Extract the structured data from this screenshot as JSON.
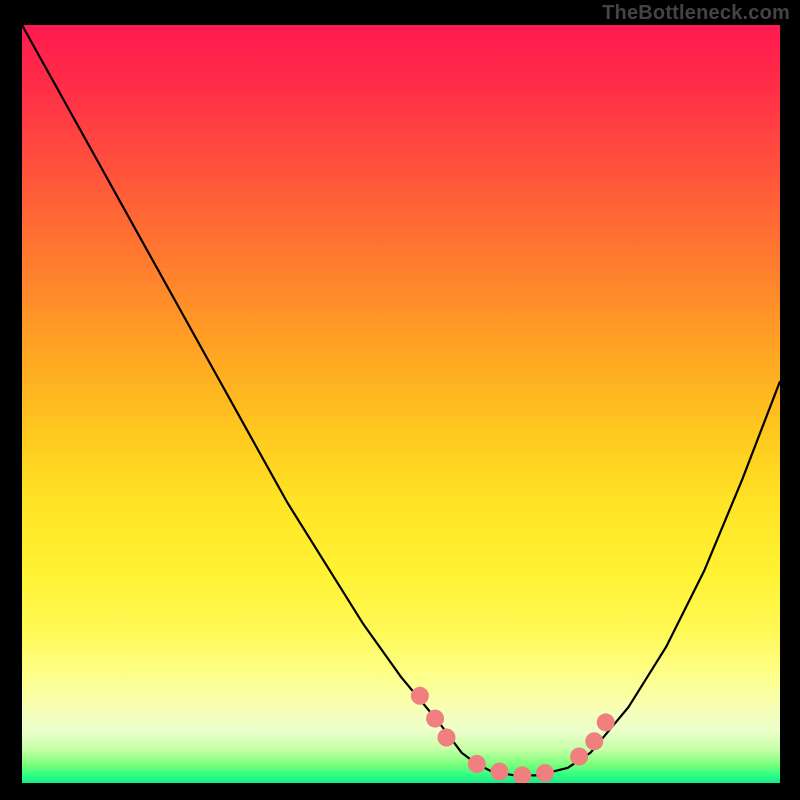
{
  "attribution": "TheBottleneck.com",
  "chart_data": {
    "type": "line",
    "title": "",
    "xlabel": "",
    "ylabel": "",
    "xlim": [
      0,
      100
    ],
    "ylim": [
      0,
      100
    ],
    "grid": false,
    "legend": false,
    "series": [
      {
        "name": "curve",
        "color": "#000000",
        "x": [
          0,
          5,
          10,
          15,
          20,
          25,
          30,
          35,
          40,
          45,
          50,
          55,
          58,
          60,
          62,
          65,
          68,
          72,
          75,
          80,
          85,
          90,
          95,
          100
        ],
        "y": [
          100,
          91,
          82,
          73,
          64,
          55,
          46,
          37,
          29,
          21,
          14,
          8,
          4,
          2.5,
          1.5,
          1,
          1,
          2,
          4,
          10,
          18,
          28,
          40,
          53
        ]
      },
      {
        "name": "markers",
        "color": "#f08080",
        "points": [
          {
            "x": 52.5,
            "y": 11.5
          },
          {
            "x": 54.5,
            "y": 8.5
          },
          {
            "x": 56.0,
            "y": 6.0
          },
          {
            "x": 60.0,
            "y": 2.5
          },
          {
            "x": 63.0,
            "y": 1.5
          },
          {
            "x": 66.0,
            "y": 1.0
          },
          {
            "x": 69.0,
            "y": 1.3
          },
          {
            "x": 73.5,
            "y": 3.5
          },
          {
            "x": 75.5,
            "y": 5.5
          },
          {
            "x": 77.0,
            "y": 8.0
          }
        ]
      }
    ],
    "colors": {
      "gradient_top": "#ff1a50",
      "gradient_mid": "#ffe326",
      "gradient_bottom": "#18e889",
      "curve": "#000000",
      "markers": "#f08080",
      "frame": "#000000"
    }
  }
}
